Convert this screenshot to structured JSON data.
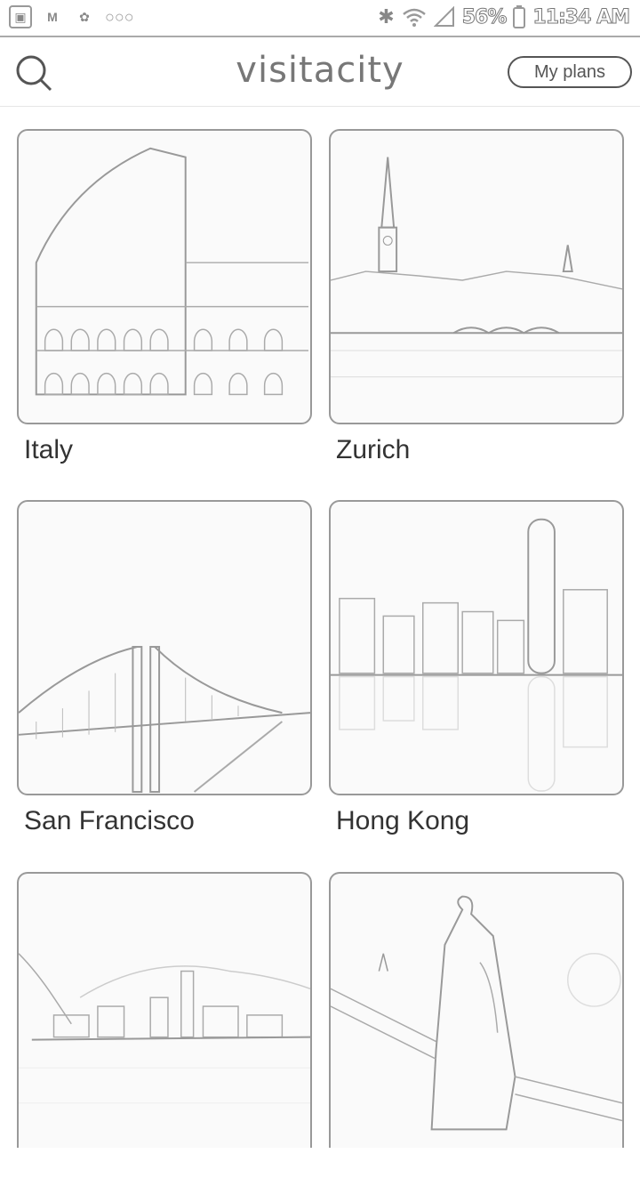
{
  "status_bar": {
    "battery": "56%",
    "time": "11:34 AM",
    "left_icons": [
      "gallery-icon",
      "gmail-icon",
      "flower-icon",
      "more-dots-icon"
    ],
    "right_icons": [
      "bluetooth-icon",
      "wifi-icon",
      "signal-icon",
      "battery-icon"
    ]
  },
  "header": {
    "logo": "visitacity",
    "my_plans_label": "My plans",
    "search_icon": "search-icon"
  },
  "cities": [
    {
      "name": "Italy",
      "image": "colosseum"
    },
    {
      "name": "Zurich",
      "image": "zurich-river"
    },
    {
      "name": "San Francisco",
      "image": "golden-gate-bridge"
    },
    {
      "name": "Hong Kong",
      "image": "hong-kong-skyline"
    },
    {
      "name": "",
      "image": "lakeside-town"
    },
    {
      "name": "",
      "image": "statue-bridge"
    }
  ]
}
